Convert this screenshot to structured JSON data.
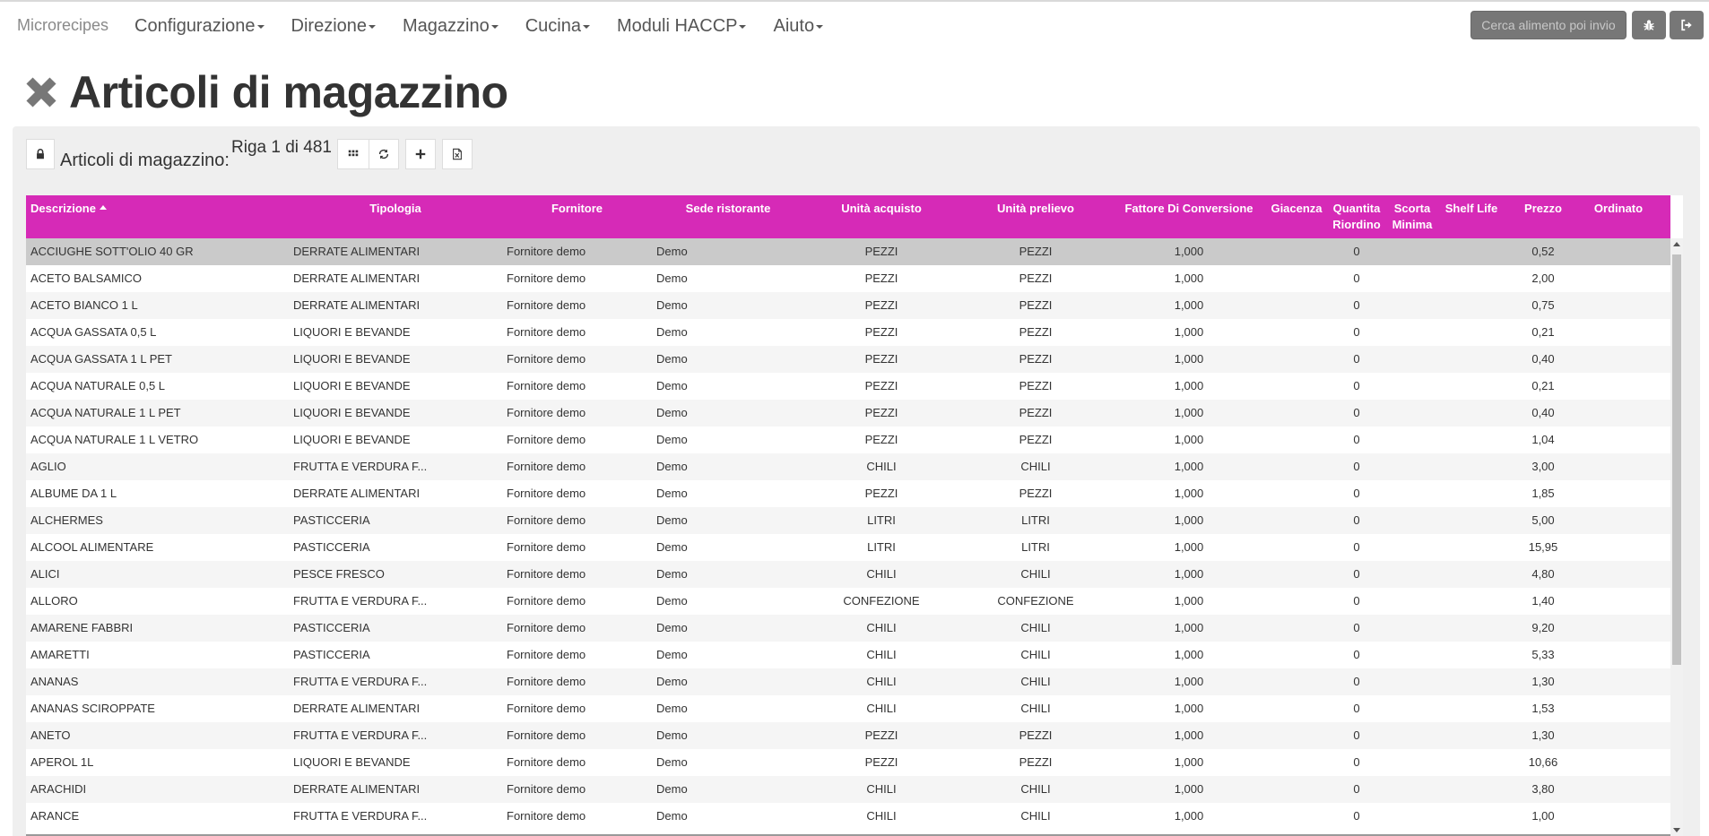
{
  "navbar": {
    "brand": "Microrecipes",
    "items": [
      {
        "label": "Configurazione"
      },
      {
        "label": "Direzione"
      },
      {
        "label": "Magazzino"
      },
      {
        "label": "Cucina"
      },
      {
        "label": "Moduli HACCP"
      },
      {
        "label": "Aiuto"
      }
    ],
    "search_label": "Cerca alimento poi invio",
    "icons": {
      "debug": "bug-icon",
      "logout": "logout-icon"
    }
  },
  "page": {
    "title": "Articoli di magazzino",
    "close_icon": "close-x-icon"
  },
  "toolbar": {
    "lock_icon": "lock-icon",
    "label": "Articoli di magazzino:",
    "row_info": "Riga 1 di 481",
    "icons": [
      "grid-icon",
      "refresh-icon",
      "plus-icon",
      "excel-export-icon"
    ]
  },
  "colors": {
    "header_bg": "#d62ab7",
    "selected_row": "#cacaca",
    "button_gray": "#777777"
  },
  "table": {
    "sorted_column": "Descrizione",
    "columns": [
      {
        "label": "Descrizione"
      },
      {
        "label": "Tipologia"
      },
      {
        "label": "Fornitore"
      },
      {
        "label": "Sede ristorante"
      },
      {
        "label": "Unità acquisto"
      },
      {
        "label": "Unità prelievo"
      },
      {
        "label": "Fattore Di Conversione"
      },
      {
        "label": "Giacenza"
      },
      {
        "label": "Quantita Riordino"
      },
      {
        "label": "Scorta Minima"
      },
      {
        "label": "Shelf Life"
      },
      {
        "label": "Prezzo"
      },
      {
        "label": "Ordinato"
      }
    ],
    "rows": [
      [
        "ACCIUGHE SOTT'OLIO 40 GR",
        "DERRATE ALIMENTARI",
        "Fornitore demo",
        "Demo",
        "PEZZI",
        "PEZZI",
        "1,000",
        "",
        "0",
        "",
        "",
        "0,52",
        ""
      ],
      [
        "ACETO BALSAMICO",
        "DERRATE ALIMENTARI",
        "Fornitore demo",
        "Demo",
        "PEZZI",
        "PEZZI",
        "1,000",
        "",
        "0",
        "",
        "",
        "2,00",
        ""
      ],
      [
        "ACETO BIANCO 1 L",
        "DERRATE ALIMENTARI",
        "Fornitore demo",
        "Demo",
        "PEZZI",
        "PEZZI",
        "1,000",
        "",
        "0",
        "",
        "",
        "0,75",
        ""
      ],
      [
        "ACQUA GASSATA 0,5 L",
        "LIQUORI E BEVANDE",
        "Fornitore demo",
        "Demo",
        "PEZZI",
        "PEZZI",
        "1,000",
        "",
        "0",
        "",
        "",
        "0,21",
        ""
      ],
      [
        "ACQUA GASSATA 1 L PET",
        "LIQUORI E BEVANDE",
        "Fornitore demo",
        "Demo",
        "PEZZI",
        "PEZZI",
        "1,000",
        "",
        "0",
        "",
        "",
        "0,40",
        ""
      ],
      [
        "ACQUA NATURALE 0,5 L",
        "LIQUORI E BEVANDE",
        "Fornitore demo",
        "Demo",
        "PEZZI",
        "PEZZI",
        "1,000",
        "",
        "0",
        "",
        "",
        "0,21",
        ""
      ],
      [
        "ACQUA NATURALE 1 L PET",
        "LIQUORI E BEVANDE",
        "Fornitore demo",
        "Demo",
        "PEZZI",
        "PEZZI",
        "1,000",
        "",
        "0",
        "",
        "",
        "0,40",
        ""
      ],
      [
        "ACQUA NATURALE 1 L VETRO",
        "LIQUORI E BEVANDE",
        "Fornitore demo",
        "Demo",
        "PEZZI",
        "PEZZI",
        "1,000",
        "",
        "0",
        "",
        "",
        "1,04",
        ""
      ],
      [
        "AGLIO",
        "FRUTTA E VERDURA F...",
        "Fornitore demo",
        "Demo",
        "CHILI",
        "CHILI",
        "1,000",
        "",
        "0",
        "",
        "",
        "3,00",
        ""
      ],
      [
        "ALBUME DA 1 L",
        "DERRATE ALIMENTARI",
        "Fornitore demo",
        "Demo",
        "PEZZI",
        "PEZZI",
        "1,000",
        "",
        "0",
        "",
        "",
        "1,85",
        ""
      ],
      [
        "ALCHERMES",
        "PASTICCERIA",
        "Fornitore demo",
        "Demo",
        "LITRI",
        "LITRI",
        "1,000",
        "",
        "0",
        "",
        "",
        "5,00",
        ""
      ],
      [
        "ALCOOL ALIMENTARE",
        "PASTICCERIA",
        "Fornitore demo",
        "Demo",
        "LITRI",
        "LITRI",
        "1,000",
        "",
        "0",
        "",
        "",
        "15,95",
        ""
      ],
      [
        "ALICI",
        "PESCE FRESCO",
        "Fornitore demo",
        "Demo",
        "CHILI",
        "CHILI",
        "1,000",
        "",
        "0",
        "",
        "",
        "4,80",
        ""
      ],
      [
        "ALLORO",
        "FRUTTA E VERDURA F...",
        "Fornitore demo",
        "Demo",
        "CONFEZIONE",
        "CONFEZIONE",
        "1,000",
        "",
        "0",
        "",
        "",
        "1,40",
        ""
      ],
      [
        "AMARENE FABBRI",
        "PASTICCERIA",
        "Fornitore demo",
        "Demo",
        "CHILI",
        "CHILI",
        "1,000",
        "",
        "0",
        "",
        "",
        "9,20",
        ""
      ],
      [
        "AMARETTI",
        "PASTICCERIA",
        "Fornitore demo",
        "Demo",
        "CHILI",
        "CHILI",
        "1,000",
        "",
        "0",
        "",
        "",
        "5,33",
        ""
      ],
      [
        "ANANAS",
        "FRUTTA E VERDURA F...",
        "Fornitore demo",
        "Demo",
        "CHILI",
        "CHILI",
        "1,000",
        "",
        "0",
        "",
        "",
        "1,30",
        ""
      ],
      [
        "ANANAS SCIROPPATE",
        "DERRATE ALIMENTARI",
        "Fornitore demo",
        "Demo",
        "CHILI",
        "CHILI",
        "1,000",
        "",
        "0",
        "",
        "",
        "1,53",
        ""
      ],
      [
        "ANETO",
        "FRUTTA E VERDURA F...",
        "Fornitore demo",
        "Demo",
        "PEZZI",
        "PEZZI",
        "1,000",
        "",
        "0",
        "",
        "",
        "1,30",
        ""
      ],
      [
        "APEROL 1L",
        "LIQUORI E BEVANDE",
        "Fornitore demo",
        "Demo",
        "PEZZI",
        "PEZZI",
        "1,000",
        "",
        "0",
        "",
        "",
        "10,66",
        ""
      ],
      [
        "ARACHIDI",
        "DERRATE ALIMENTARI",
        "Fornitore demo",
        "Demo",
        "CHILI",
        "CHILI",
        "1,000",
        "",
        "0",
        "",
        "",
        "3,80",
        ""
      ],
      [
        "ARANCE",
        "FRUTTA E VERDURA F...",
        "Fornitore demo",
        "Demo",
        "CHILI",
        "CHILI",
        "1,000",
        "",
        "0",
        "",
        "",
        "1,00",
        ""
      ]
    ]
  }
}
